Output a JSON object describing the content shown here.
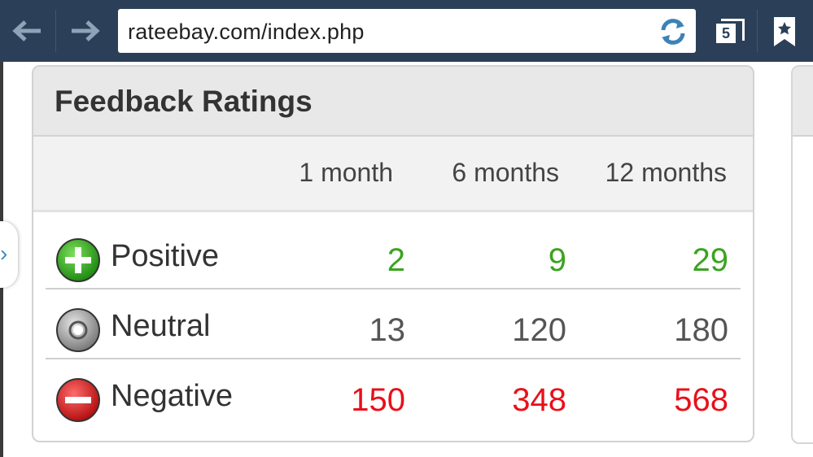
{
  "browser": {
    "url": "rateebay.com/index.php",
    "tab_count": "5"
  },
  "card": {
    "title": "Feedback Ratings",
    "columns": [
      "1 month",
      "6 months",
      "12 months"
    ],
    "rows": [
      {
        "label": "Positive",
        "icon": "plus-circle-icon",
        "color": "#3aa41f",
        "values": [
          "2",
          "9",
          "29"
        ]
      },
      {
        "label": "Neutral",
        "icon": "neutral-circle-icon",
        "color": "#555555",
        "values": [
          "13",
          "120",
          "180"
        ]
      },
      {
        "label": "Negative",
        "icon": "minus-circle-icon",
        "color": "#e8101a",
        "values": [
          "150",
          "348",
          "568"
        ]
      }
    ]
  },
  "colors": {
    "toolbar": "#2b4058",
    "positive": "#3aa41f",
    "neutral": "#555555",
    "negative": "#e8101a"
  }
}
